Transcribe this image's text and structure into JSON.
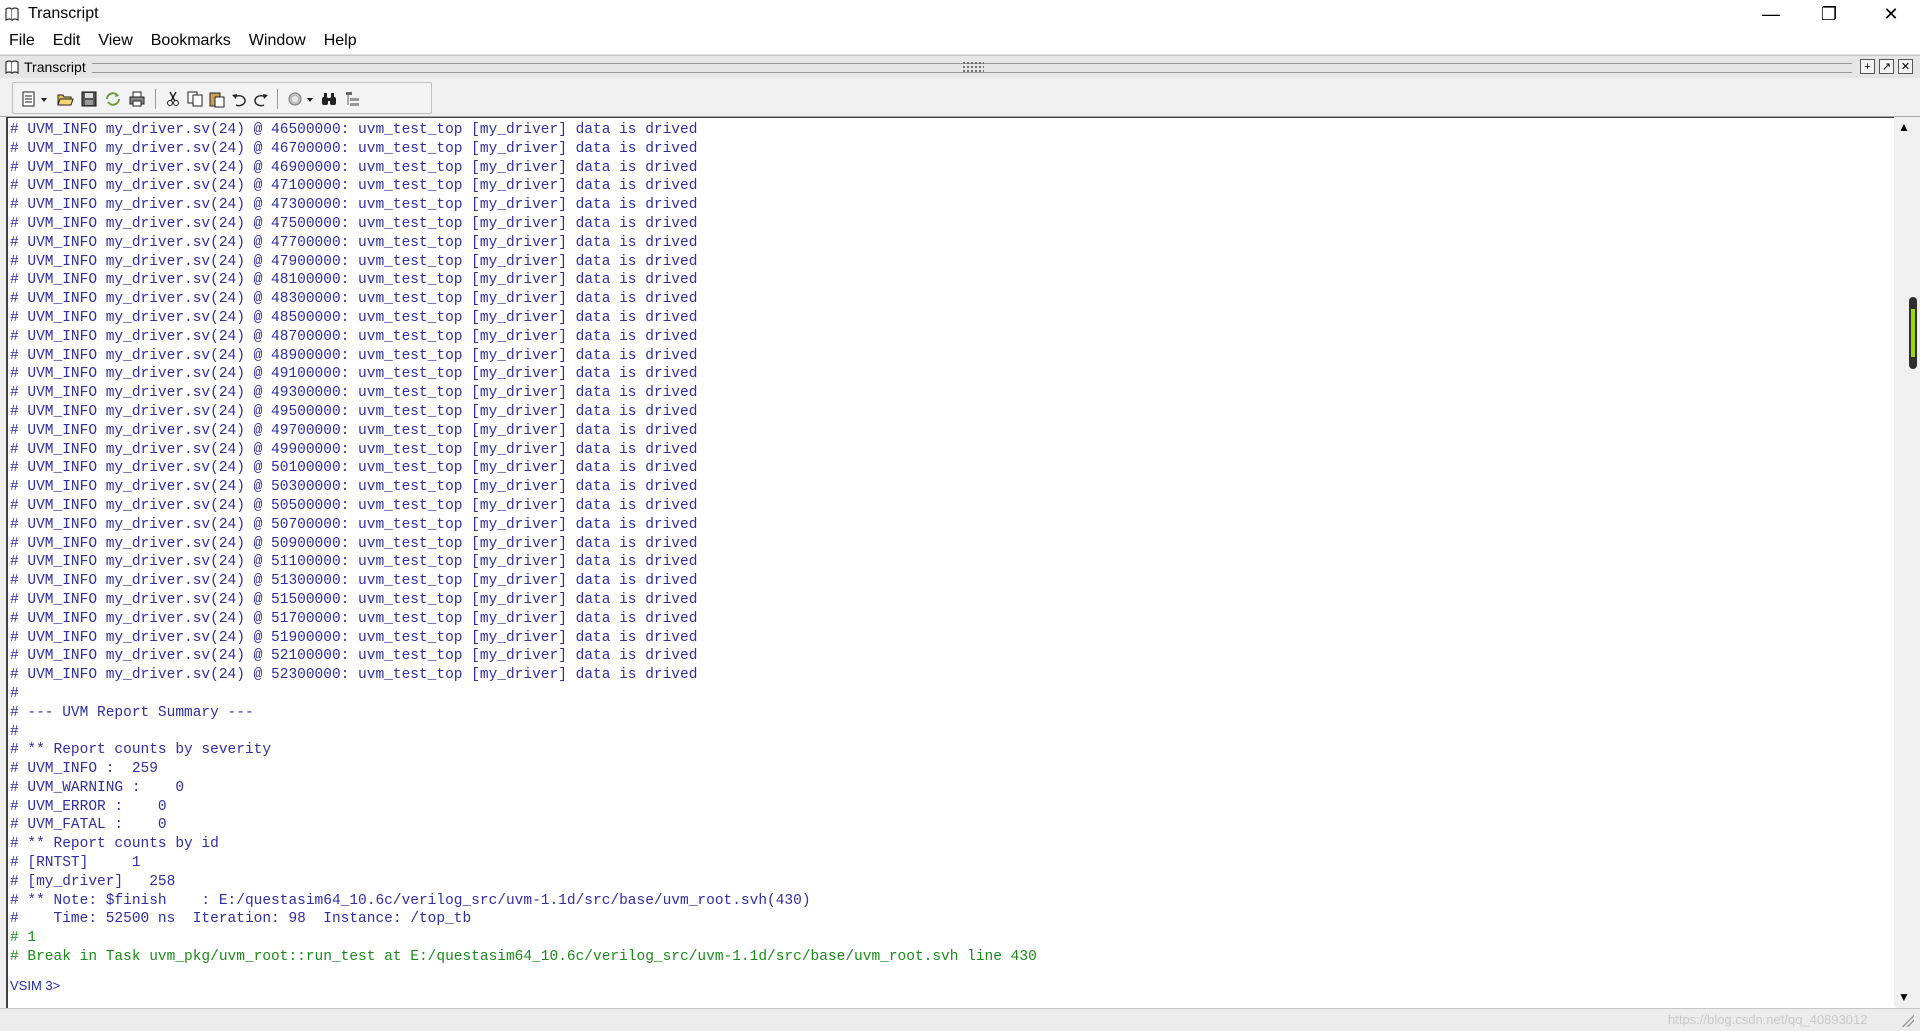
{
  "window": {
    "title": "Transcript",
    "minimize": "—",
    "maximize": "❐",
    "close": "✕"
  },
  "menubar": {
    "items": [
      "File",
      "Edit",
      "View",
      "Bookmarks",
      "Window",
      "Help"
    ]
  },
  "pane": {
    "title": "Transcript"
  },
  "toolbar": {
    "icons": [
      "new-icon",
      "dropdown-arrow-icon",
      "open-folder-icon",
      "save-icon",
      "reload-icon",
      "print-icon",
      "cut-icon",
      "copy-icon",
      "paste-icon",
      "undo-icon",
      "redo-icon",
      "find-icon",
      "dropdown-arrow-icon",
      "binoculars-icon",
      "format-icon"
    ]
  },
  "transcript": {
    "lines": [
      "# UVM_INFO my_driver.sv(24) @ 46500000: uvm_test_top [my_driver] data is drived",
      "# UVM_INFO my_driver.sv(24) @ 46700000: uvm_test_top [my_driver] data is drived",
      "# UVM_INFO my_driver.sv(24) @ 46900000: uvm_test_top [my_driver] data is drived",
      "# UVM_INFO my_driver.sv(24) @ 47100000: uvm_test_top [my_driver] data is drived",
      "# UVM_INFO my_driver.sv(24) @ 47300000: uvm_test_top [my_driver] data is drived",
      "# UVM_INFO my_driver.sv(24) @ 47500000: uvm_test_top [my_driver] data is drived",
      "# UVM_INFO my_driver.sv(24) @ 47700000: uvm_test_top [my_driver] data is drived",
      "# UVM_INFO my_driver.sv(24) @ 47900000: uvm_test_top [my_driver] data is drived",
      "# UVM_INFO my_driver.sv(24) @ 48100000: uvm_test_top [my_driver] data is drived",
      "# UVM_INFO my_driver.sv(24) @ 48300000: uvm_test_top [my_driver] data is drived",
      "# UVM_INFO my_driver.sv(24) @ 48500000: uvm_test_top [my_driver] data is drived",
      "# UVM_INFO my_driver.sv(24) @ 48700000: uvm_test_top [my_driver] data is drived",
      "# UVM_INFO my_driver.sv(24) @ 48900000: uvm_test_top [my_driver] data is drived",
      "# UVM_INFO my_driver.sv(24) @ 49100000: uvm_test_top [my_driver] data is drived",
      "# UVM_INFO my_driver.sv(24) @ 49300000: uvm_test_top [my_driver] data is drived",
      "# UVM_INFO my_driver.sv(24) @ 49500000: uvm_test_top [my_driver] data is drived",
      "# UVM_INFO my_driver.sv(24) @ 49700000: uvm_test_top [my_driver] data is drived",
      "# UVM_INFO my_driver.sv(24) @ 49900000: uvm_test_top [my_driver] data is drived",
      "# UVM_INFO my_driver.sv(24) @ 50100000: uvm_test_top [my_driver] data is drived",
      "# UVM_INFO my_driver.sv(24) @ 50300000: uvm_test_top [my_driver] data is drived",
      "# UVM_INFO my_driver.sv(24) @ 50500000: uvm_test_top [my_driver] data is drived",
      "# UVM_INFO my_driver.sv(24) @ 50700000: uvm_test_top [my_driver] data is drived",
      "# UVM_INFO my_driver.sv(24) @ 50900000: uvm_test_top [my_driver] data is drived",
      "# UVM_INFO my_driver.sv(24) @ 51100000: uvm_test_top [my_driver] data is drived",
      "# UVM_INFO my_driver.sv(24) @ 51300000: uvm_test_top [my_driver] data is drived",
      "# UVM_INFO my_driver.sv(24) @ 51500000: uvm_test_top [my_driver] data is drived",
      "# UVM_INFO my_driver.sv(24) @ 51700000: uvm_test_top [my_driver] data is drived",
      "# UVM_INFO my_driver.sv(24) @ 51900000: uvm_test_top [my_driver] data is drived",
      "# UVM_INFO my_driver.sv(24) @ 52100000: uvm_test_top [my_driver] data is drived",
      "# UVM_INFO my_driver.sv(24) @ 52300000: uvm_test_top [my_driver] data is drived",
      "#",
      "# --- UVM Report Summary ---",
      "#",
      "# ** Report counts by severity",
      "# UVM_INFO :  259",
      "# UVM_WARNING :    0",
      "# UVM_ERROR :    0",
      "# UVM_FATAL :    0",
      "# ** Report counts by id",
      "# [RNTST]     1",
      "# [my_driver]   258",
      "# ** Note: $finish    : E:/questasim64_10.6c/verilog_src/uvm-1.1d/src/base/uvm_root.svh(430)",
      "#    Time: 52500 ns  Iteration: 98  Instance: /top_tb",
      "# 1",
      "# Break in Task uvm_pkg/uvm_root::run_test at E:/questasim64_10.6c/verilog_src/uvm-1.1d/src/base/uvm_root.svh line 430"
    ],
    "green_from_index": 43,
    "prompt": "VSIM 3>"
  },
  "colors": {
    "text": "#2f2f9f",
    "green": "#1b8a1b",
    "scroll_marker": "#9fd600"
  },
  "statusbar": {
    "watermark": "https://blog.csdn.net/qq_40893012"
  },
  "scrollbar": {
    "up_arrow": "▲",
    "down_arrow": "▼"
  }
}
